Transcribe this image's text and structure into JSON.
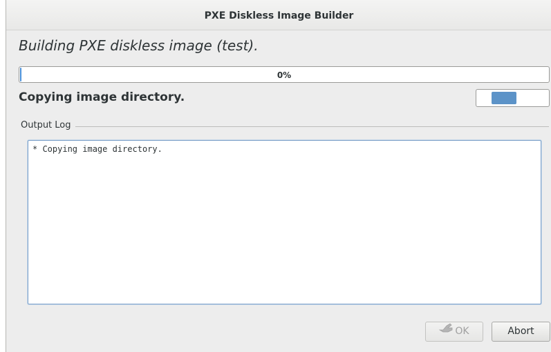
{
  "window": {
    "title": "PXE Diskless Image Builder"
  },
  "heading": "Building PXE diskless image (test).",
  "progress": {
    "value": 0.0,
    "label": "0%"
  },
  "status": "Copying image directory.",
  "log": {
    "frame_label": "Output Log",
    "text": "* Copying image directory."
  },
  "buttons": {
    "ok_label": "OK",
    "ok_icon": "ok-hand-icon",
    "abort_label": "Abort"
  },
  "colors": {
    "progress_fill": "#4a90d9",
    "pulse_block": "#5c93c8"
  }
}
